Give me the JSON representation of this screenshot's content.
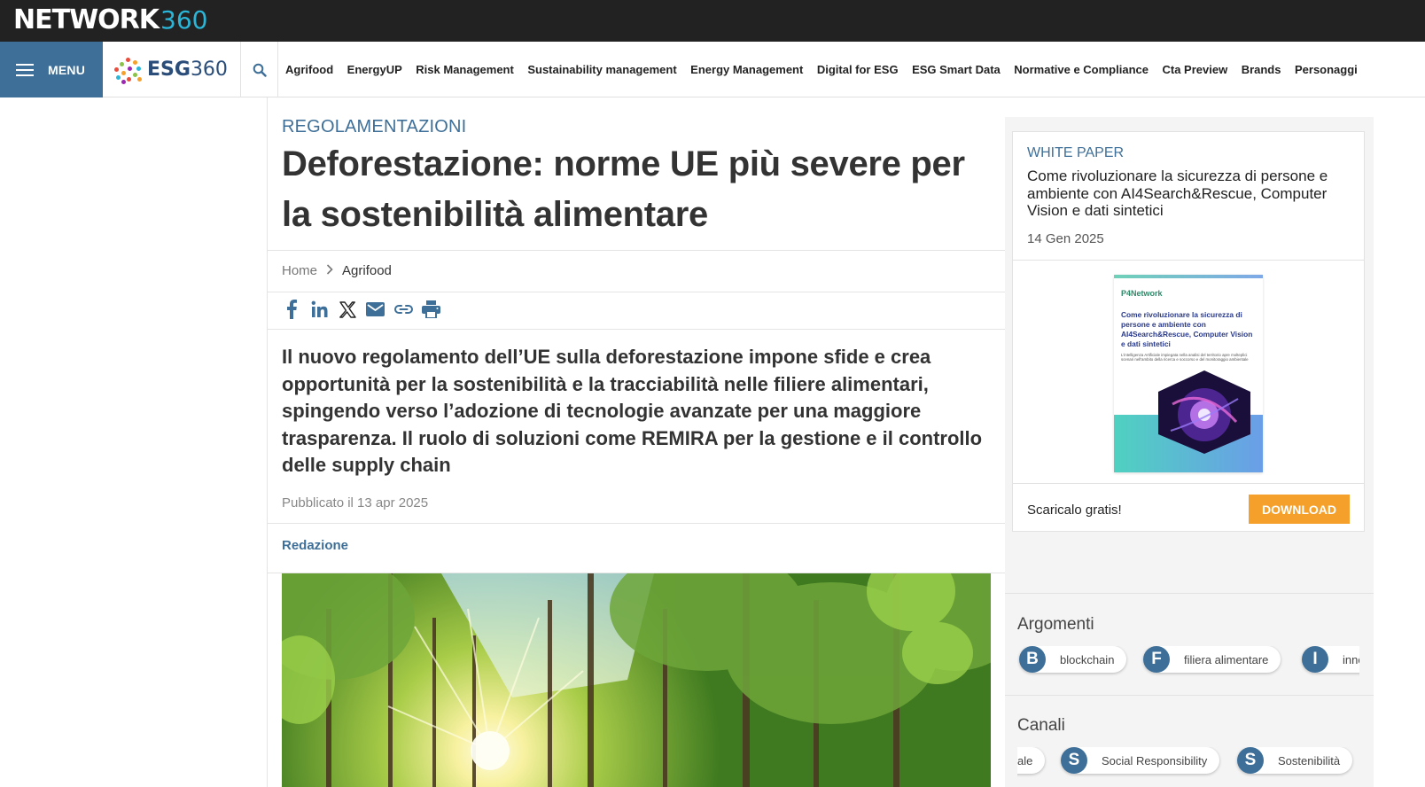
{
  "network": {
    "brand_word": "NETWORK",
    "brand_num": "360"
  },
  "nav": {
    "menu_label": "MENU",
    "site_brand": "ESG",
    "site_num": "360",
    "links": [
      "Agrifood",
      "EnergyUP",
      "Risk Management",
      "Sustainability management",
      "Energy Management",
      "Digital for ESG",
      "ESG Smart Data",
      "Normative e Compliance",
      "Cta Preview",
      "Brands",
      "Personaggi"
    ]
  },
  "article": {
    "category": "REGOLAMENTAZIONI",
    "title": "Deforestazione: norme UE più severe per la sostenibilità alimentare",
    "breadcrumb": {
      "home": "Home",
      "current": "Agrifood"
    },
    "summary": "Il nuovo regolamento dell’UE sulla deforestazione impone sfide e crea opportunità per la sostenibilità e la tracciabilità nelle filiere alimentari, spingendo verso l’adozione di tecnologie avanzate per una maggiore trasparenza. Il ruolo di soluzioni come REMIRA per la gestione e il controllo delle supply chain",
    "published": "Pubblicato il 13 apr 2025",
    "author": "Redazione"
  },
  "sidebar": {
    "whitepaper": {
      "kicker": "WHITE PAPER",
      "title": "Come rivoluzionare la sicurezza di persone e ambiente con AI4Search&Rescue, Computer Vision e dati sintetici",
      "date": "14 Gen 2025",
      "cover_brand": "P4Network",
      "cover_title": "Come rivoluzionare la sicurezza di persone e ambiente con AI4Search&Rescue, Computer Vision e dati sintetici",
      "cover_sub": "L'intelligenza Artificiale impiegata nella analisi del territorio apre molteplici scenari nell'ambito della ricerca e soccorso e del monitoraggio ambientale",
      "cta": "Scaricalo gratis!",
      "button": "DOWNLOAD"
    },
    "topics_heading": "Argomenti",
    "topics": [
      {
        "letter": "B",
        "label": "blockchain"
      },
      {
        "letter": "F",
        "label": "filiera alimentare"
      },
      {
        "letter": "I",
        "label": "innovazione"
      }
    ],
    "channels_heading": "Canali",
    "channels": [
      {
        "letter": "",
        "label": "ale"
      },
      {
        "letter": "S",
        "label": "Social Responsibility"
      },
      {
        "letter": "S",
        "label": "Sostenibilità"
      }
    ]
  },
  "colors": {
    "primary": "#3e6f98",
    "accent": "#f5a02a",
    "topbar": "#222222"
  }
}
